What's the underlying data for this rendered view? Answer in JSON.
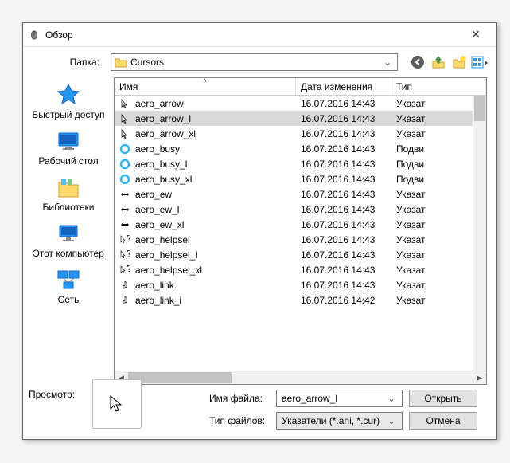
{
  "window": {
    "title": "Обзор",
    "close_tooltip": "Закрыть"
  },
  "folder": {
    "label": "Папка:",
    "value": "Cursors"
  },
  "columns": {
    "name": "Имя",
    "modified": "Дата изменения",
    "type": "Тип"
  },
  "places": [
    {
      "label": "Быстрый доступ",
      "icon": "star"
    },
    {
      "label": "Рабочий стол",
      "icon": "desktop"
    },
    {
      "label": "Библиотеки",
      "icon": "libraries"
    },
    {
      "label": "Этот компьютер",
      "icon": "computer"
    },
    {
      "label": "Сеть",
      "icon": "network"
    }
  ],
  "files": [
    {
      "name": "aero_arrow",
      "date": "16.07.2016 14:43",
      "type": "Указат",
      "icon": "arrow",
      "selected": false
    },
    {
      "name": "aero_arrow_l",
      "date": "16.07.2016 14:43",
      "type": "Указат",
      "icon": "arrow",
      "selected": true
    },
    {
      "name": "aero_arrow_xl",
      "date": "16.07.2016 14:43",
      "type": "Указат",
      "icon": "arrow",
      "selected": false
    },
    {
      "name": "aero_busy",
      "date": "16.07.2016 14:43",
      "type": "Подви",
      "icon": "busy",
      "selected": false
    },
    {
      "name": "aero_busy_l",
      "date": "16.07.2016 14:43",
      "type": "Подви",
      "icon": "busy",
      "selected": false
    },
    {
      "name": "aero_busy_xl",
      "date": "16.07.2016 14:43",
      "type": "Подви",
      "icon": "busy",
      "selected": false
    },
    {
      "name": "aero_ew",
      "date": "16.07.2016 14:43",
      "type": "Указат",
      "icon": "ew",
      "selected": false
    },
    {
      "name": "aero_ew_l",
      "date": "16.07.2016 14:43",
      "type": "Указат",
      "icon": "ew",
      "selected": false
    },
    {
      "name": "aero_ew_xl",
      "date": "16.07.2016 14:43",
      "type": "Указат",
      "icon": "ew",
      "selected": false
    },
    {
      "name": "aero_helpsel",
      "date": "16.07.2016 14:43",
      "type": "Указат",
      "icon": "help",
      "selected": false
    },
    {
      "name": "aero_helpsel_l",
      "date": "16.07.2016 14:43",
      "type": "Указат",
      "icon": "help",
      "selected": false
    },
    {
      "name": "aero_helpsel_xl",
      "date": "16.07.2016 14:43",
      "type": "Указат",
      "icon": "help",
      "selected": false
    },
    {
      "name": "aero_link",
      "date": "16.07.2016 14:43",
      "type": "Указат",
      "icon": "link",
      "selected": false
    },
    {
      "name": "aero_link_i",
      "date": "16.07.2016 14:42",
      "type": "Указат",
      "icon": "link",
      "selected": false
    }
  ],
  "filename": {
    "label": "Имя файла:",
    "value": "aero_arrow_l"
  },
  "filetype": {
    "label": "Тип файлов:",
    "value": "Указатели (*.ani, *.cur)"
  },
  "buttons": {
    "open": "Открыть",
    "cancel": "Отмена"
  },
  "preview": {
    "label": "Просмотр:"
  }
}
